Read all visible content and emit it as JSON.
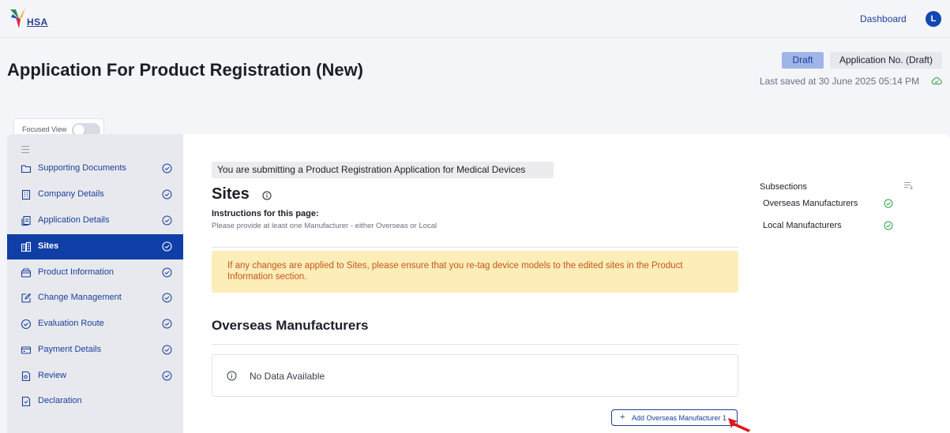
{
  "header": {
    "logo_text": "HSA",
    "dashboard_label": "Dashboard",
    "avatar_initial": "L"
  },
  "page": {
    "title": "Application For Product Registration (New)",
    "status_badge": "Draft",
    "application_no": "Application No. (Draft)",
    "last_saved": "Last saved at 30 June 2025 05:14 PM",
    "focused_view_label": "Focused View",
    "focused_view_on": false
  },
  "sidebar": {
    "items": [
      {
        "label": "Supporting Documents",
        "icon": "folder-icon",
        "completed": true,
        "active": false
      },
      {
        "label": "Company Details",
        "icon": "building-icon",
        "completed": true,
        "active": false
      },
      {
        "label": "Application Details",
        "icon": "document-stack-icon",
        "completed": true,
        "active": false
      },
      {
        "label": "Sites",
        "icon": "buildings-icon",
        "completed": true,
        "active": true
      },
      {
        "label": "Product Information",
        "icon": "box-icon",
        "completed": true,
        "active": false
      },
      {
        "label": "Change Management",
        "icon": "edit-icon",
        "completed": true,
        "active": false
      },
      {
        "label": "Evaluation Route",
        "icon": "check-circle-icon",
        "completed": true,
        "active": false
      },
      {
        "label": "Payment Details",
        "icon": "credit-card-icon",
        "completed": true,
        "active": false
      },
      {
        "label": "Review",
        "icon": "review-document-icon",
        "completed": true,
        "active": false
      },
      {
        "label": "Declaration",
        "icon": "declaration-document-icon",
        "completed": false,
        "active": false
      }
    ]
  },
  "main": {
    "submit_banner": "You are submitting a Product Registration Application for Medical Devices",
    "section_title": "Sites",
    "instructions_title": "Instructions for this page:",
    "instructions_text": "Please provide at least one Manufacturer - either Overseas or Local",
    "warning_text": "If any changes are applied to Sites, please ensure that you re-tag device models to the edited sites in the Product Information section.",
    "overseas_title": "Overseas Manufacturers",
    "no_data_text": "No Data Available",
    "add_button_label": "Add Overseas Manufacturer 1",
    "add_button_symbol": "+"
  },
  "subsections": {
    "title": "Subsections",
    "items": [
      {
        "label": "Overseas Manufacturers",
        "completed": true
      },
      {
        "label": "Local Manufacturers",
        "completed": true
      }
    ]
  },
  "colors": {
    "brand_blue": "#0f3fa6",
    "link_blue": "#1a3f99",
    "success_green": "#2ea043",
    "warning_bg": "#fdedb8",
    "warning_text": "#c2581a"
  }
}
